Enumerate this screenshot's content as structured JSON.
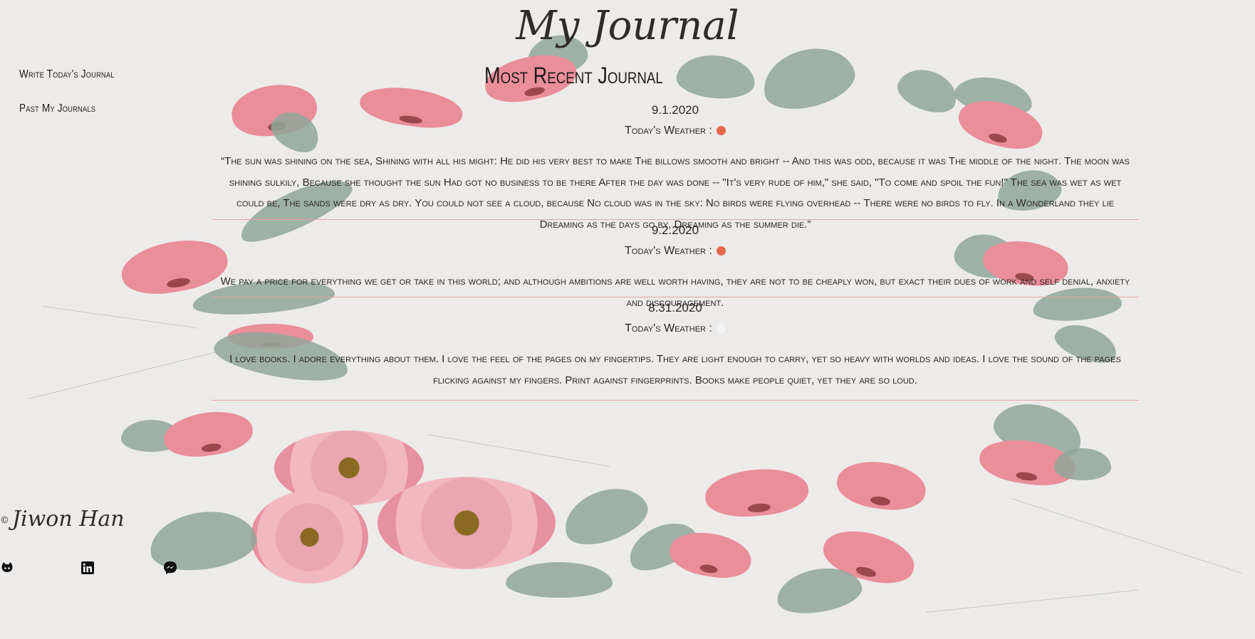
{
  "header": {
    "title": "My Journal"
  },
  "nav": {
    "items": [
      {
        "label": "Write Today's Journal"
      },
      {
        "label": "Past My Journals"
      }
    ]
  },
  "main": {
    "section_title": "Most Recent Journal",
    "weather_label": "Today's Weather :",
    "entries": [
      {
        "date": "9.1.2020",
        "weather_color": "#e8684f",
        "text": "“The sun was shining on the sea, Shining with all his might: He did his very best to make The billows smooth and bright -- And this was odd, because it was The middle of the night. The moon was shining sulkily, Because she thought the sun Had got no business to be there After the day was done -- \"It's very rude of him,\" she said, \"To come and spoil the fun!\" The sea was wet as wet could be, The sands were dry as dry. You could not see a cloud, because No cloud was in the sky: No birds were flying overhead -- There were no birds to fly. In a Wonderland they lie Dreaming as the days go by, Dreaming as the summer die.”"
      },
      {
        "date": "9.2.2020",
        "weather_color": "#e8684f",
        "text": "We pay a price for everything we get or take in this world; and although ambitions are well worth having, they are not to be cheaply won, but exact their dues of work and self denial, anxiety and discouragement."
      },
      {
        "date": "8.31.2020",
        "weather_color": "#f4f4f4",
        "text": "I love books. I adore everything about them. I love the feel of the pages on my fingertips. They are light enough to carry, yet so heavy with worlds and ideas. I love the sound of the pages flicking against my fingers. Print against fingerprints. Books make people quiet, yet they are so loud."
      }
    ]
  },
  "footer": {
    "copyright_symbol": "©",
    "author": "Jiwon Han",
    "social": [
      {
        "icon": "github-icon"
      },
      {
        "icon": "linkedin-icon"
      },
      {
        "icon": "messenger-icon"
      }
    ]
  }
}
